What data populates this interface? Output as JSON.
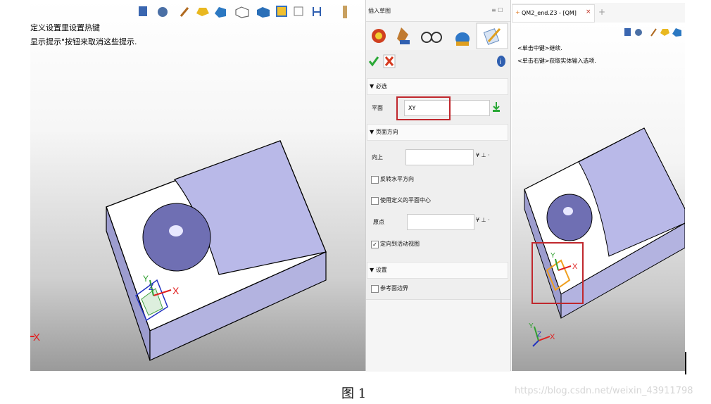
{
  "left_viewport": {
    "hint_line1": "定义设置里设置热键",
    "hint_line2": "显示提示\"按钮来取消这些提示."
  },
  "panel": {
    "title": "插入草图",
    "title_controls": "≡ ☐",
    "ok_icon": "check-icon",
    "cancel_icon": "x-icon",
    "info_icon": "info-icon",
    "section_required": "▼ 必选",
    "plane_label": "平面",
    "plane_value": "XY",
    "section_orientation": "▼ 页面方向",
    "up_label": "向上",
    "flip_horizontal_label": "反转水平方向",
    "use_custom_center_label": "使用定义的平面中心",
    "origin_label": "原点",
    "orient_to_active_view_label": "定向到活动视图",
    "orient_to_active_view_checked": true,
    "section_settings": "▼ 设置",
    "reference_boundary_label": "参考面边界"
  },
  "right_window": {
    "tab_label": "QM2_end.Z3 - [QM]",
    "tab_close": "×",
    "add_tab": "+",
    "hint_line1": "<单击中键>继续.",
    "hint_line2": "<单击右键>获取实体输入选项."
  },
  "caption": "图 1",
  "watermark": "https://blog.csdn.net/weixin_43911798",
  "colors": {
    "highlight_box": "#c0272d",
    "block_face": "#b9b9e8",
    "accept": "#2aa836",
    "reject": "#d63a1f"
  }
}
